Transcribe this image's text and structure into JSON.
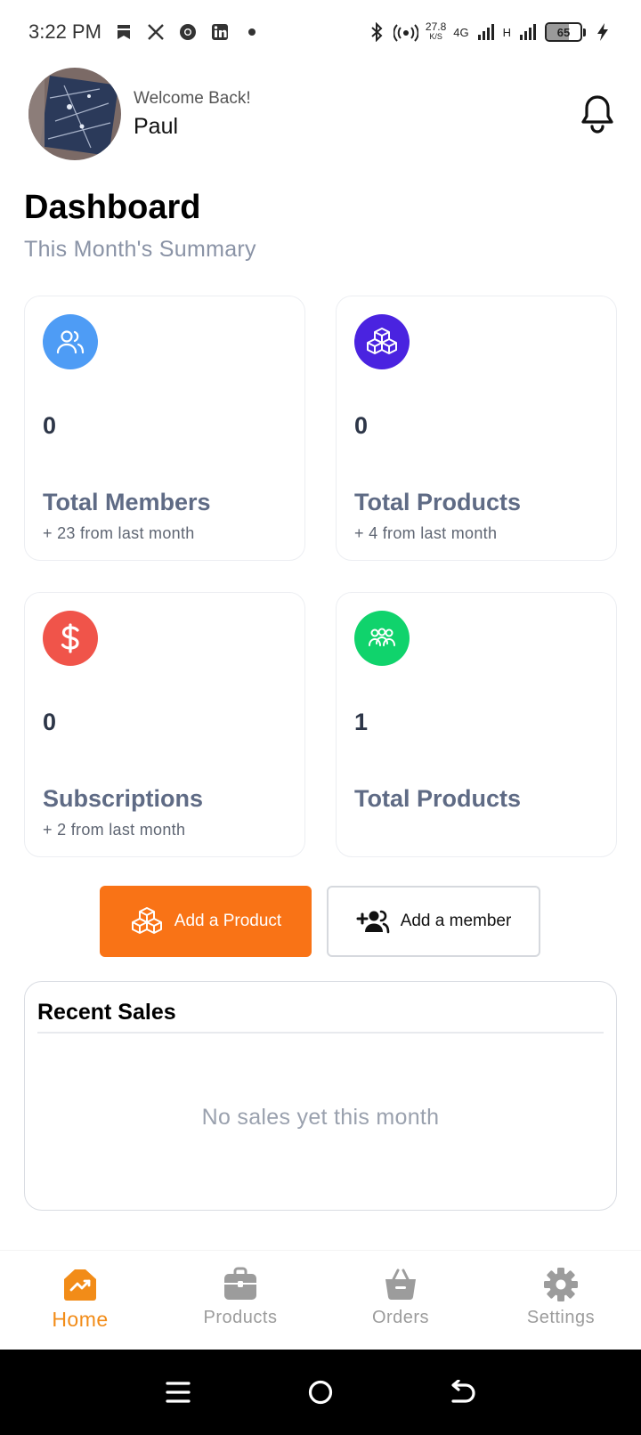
{
  "status_bar": {
    "time": "3:22 PM",
    "net_speed": "27.8",
    "net_unit": "K/S",
    "network_type": "4G",
    "signal2_type": "H",
    "battery": "65",
    "battery_level_fraction": 0.65,
    "icons": [
      "bookmark-icon",
      "x-logo-icon",
      "chrome-icon",
      "linkedin-icon",
      "dot-icon",
      "bluetooth-icon",
      "hotspot-icon",
      "signal-icon",
      "charging-icon"
    ]
  },
  "header": {
    "welcome": "Welcome Back!",
    "user_name": "Paul"
  },
  "dashboard": {
    "title": "Dashboard",
    "subtitle": "This Month's Summary"
  },
  "cards": [
    {
      "icon": "users-icon",
      "color": "#4e9cf5",
      "value": "0",
      "label": "Total Members",
      "sub": "+ 23 from last month"
    },
    {
      "icon": "boxes-icon",
      "color": "#4a23e0",
      "value": "0",
      "label": "Total Products",
      "sub": "+ 4 from last month"
    },
    {
      "icon": "dollar-icon",
      "color": "#f0544a",
      "value": "0",
      "label": "Subscriptions",
      "sub": "+ 2 from last month"
    },
    {
      "icon": "group-icon",
      "color": "#10d36c",
      "value": "1",
      "label": "Total Products",
      "sub": ""
    }
  ],
  "actions": {
    "add_product": "Add a Product",
    "add_member": "Add a member",
    "accent_color": "#f97316"
  },
  "recent_sales": {
    "title": "Recent Sales",
    "empty": "No sales yet this month"
  },
  "bottom_nav": {
    "items": [
      {
        "label": "Home",
        "icon": "home-chart-icon",
        "active": true
      },
      {
        "label": "Products",
        "icon": "briefcase-icon",
        "active": false
      },
      {
        "label": "Orders",
        "icon": "basket-icon",
        "active": false
      },
      {
        "label": "Settings",
        "icon": "gear-icon",
        "active": false
      }
    ],
    "active_color": "#f28c18"
  },
  "system_nav": [
    "menu-icon",
    "home-circle-icon",
    "back-icon"
  ]
}
